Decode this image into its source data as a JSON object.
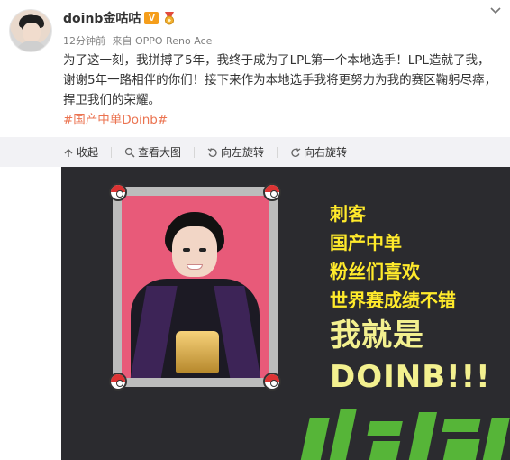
{
  "post": {
    "username": "doinb金咕咕",
    "v_badge": "V",
    "meta": {
      "time": "12分钟前",
      "source": "来自 OPPO Reno Ace"
    },
    "content_line1": "为了这一刻，我拼搏了5年，我终于成为了LPL第一个本地选手！LPL造就了我，",
    "content_line2": "谢谢5年一路相伴的你们！接下来作为本地选手我将更努力为我的赛区鞠躬尽瘁，",
    "content_line3": "捍卫我们的荣耀。",
    "hashtag": "#国产中单Doinb#"
  },
  "toolbar": {
    "collapse": "收起",
    "view_large": "查看大图",
    "rotate_left": "向左旋转",
    "rotate_right": "向右旋转"
  },
  "image": {
    "caption_lines": [
      "刺客",
      "国产中单",
      "粉丝们喜欢",
      "世界赛成绩不错"
    ],
    "caption_big1": "我就是",
    "caption_big2": "DOINB!!!"
  },
  "icons": [
    "avatar",
    "v-badge",
    "medal-icon",
    "chevron-down-icon",
    "collapse-icon",
    "zoom-icon",
    "rotate-left-icon",
    "rotate-right-icon",
    "pokeball-icon"
  ],
  "colors": {
    "hashtag": "#eb7350",
    "badge": "#f59e1b",
    "toolbar_bg": "#f2f2f5",
    "image_bg": "#2b2b2f",
    "frame_pink": "#e85a79",
    "caption_yellow": "#ffea2b"
  }
}
